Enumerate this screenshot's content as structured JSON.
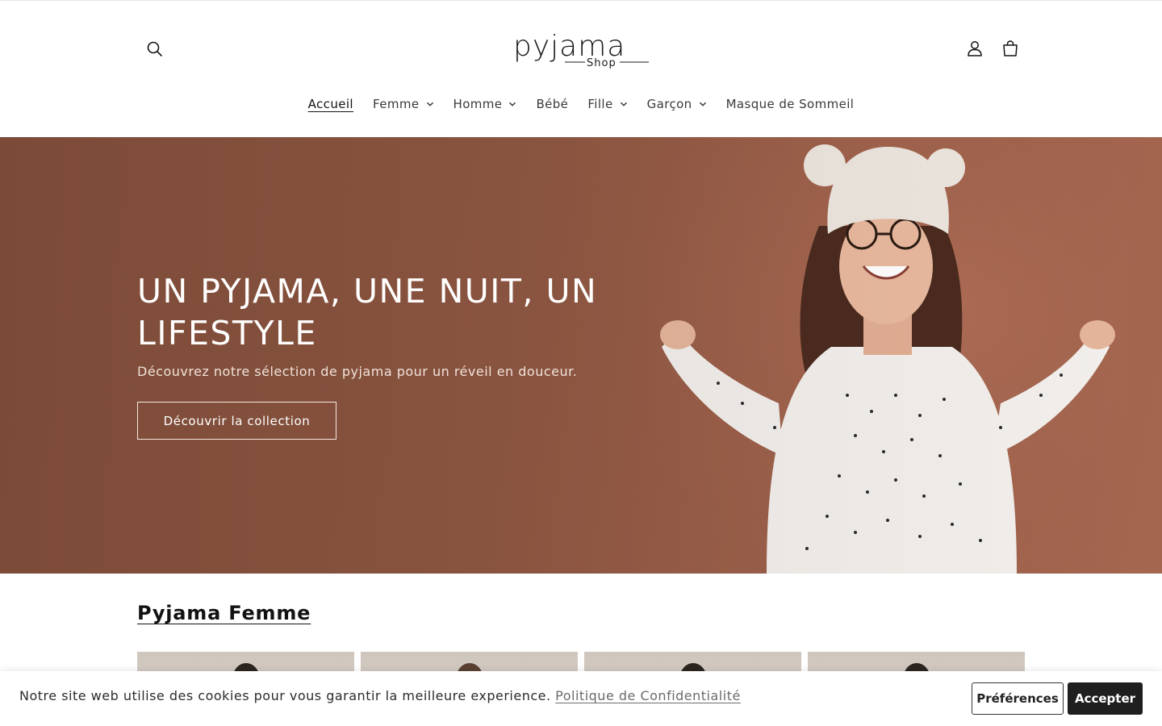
{
  "header": {
    "logo_text": "pyjama",
    "logo_sub": "Shop",
    "icons": [
      "search-icon",
      "account-icon",
      "cart-icon"
    ]
  },
  "nav": {
    "items": [
      {
        "label": "Accueil",
        "active": true,
        "has_dropdown": false
      },
      {
        "label": "Femme",
        "active": false,
        "has_dropdown": true
      },
      {
        "label": "Homme",
        "active": false,
        "has_dropdown": true
      },
      {
        "label": "Bébé",
        "active": false,
        "has_dropdown": false
      },
      {
        "label": "Fille",
        "active": false,
        "has_dropdown": true
      },
      {
        "label": "Garçon",
        "active": false,
        "has_dropdown": true
      },
      {
        "label": "Masque de Sommeil",
        "active": false,
        "has_dropdown": false
      }
    ]
  },
  "hero": {
    "title": "UN PYJAMA, UNE NUIT, UN LIFESTYLE",
    "subtitle": "Découvrez notre sélection de pyjama pour un réveil en douceur.",
    "cta_label": "Découvrir la collection",
    "background_color": "#8f5843"
  },
  "collection": {
    "title": "Pyjama Femme",
    "products_visible": 4
  },
  "cookie_bar": {
    "text": "Notre site web utilise des cookies pour vous garantir la meilleure experience.",
    "link_label": "Politique de Confidentialité",
    "preferences_label": "Préférences",
    "accept_label": "Accepter"
  }
}
